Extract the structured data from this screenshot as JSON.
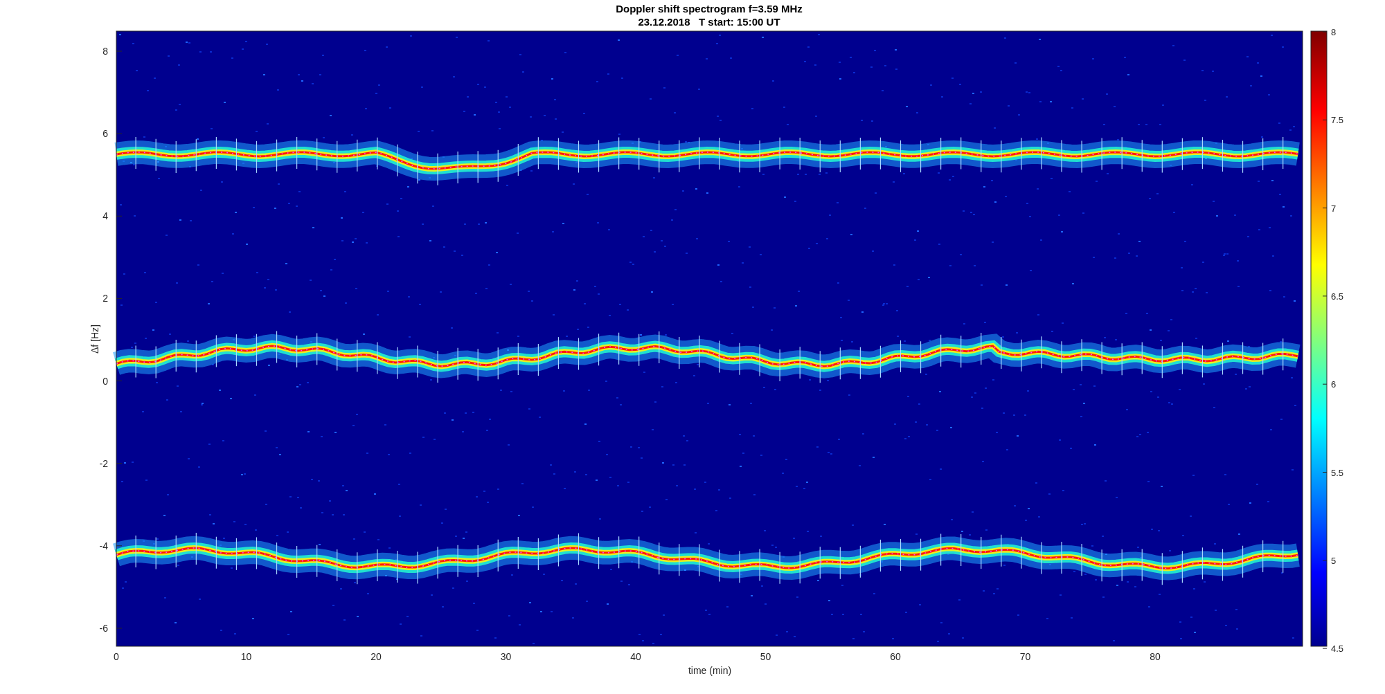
{
  "title": [
    "Doppler shift spectrogram f=3.59 MHz",
    "23.12.2018   T start: 15:00 UT"
  ],
  "axes": {
    "ylabel": "Δf [Hz]",
    "xlabel": "time (min)",
    "yticks": [
      "8",
      "6",
      "4",
      "2",
      "0",
      "-2",
      "-4",
      "-6"
    ],
    "xticks": [
      "0",
      "10",
      "20",
      "30",
      "40",
      "50",
      "60",
      "70",
      "80"
    ]
  },
  "colorbar": {
    "ticks": [
      "8",
      "7.5",
      "7",
      "6.5",
      "6",
      "5.5",
      "5",
      "4.5"
    ]
  }
}
